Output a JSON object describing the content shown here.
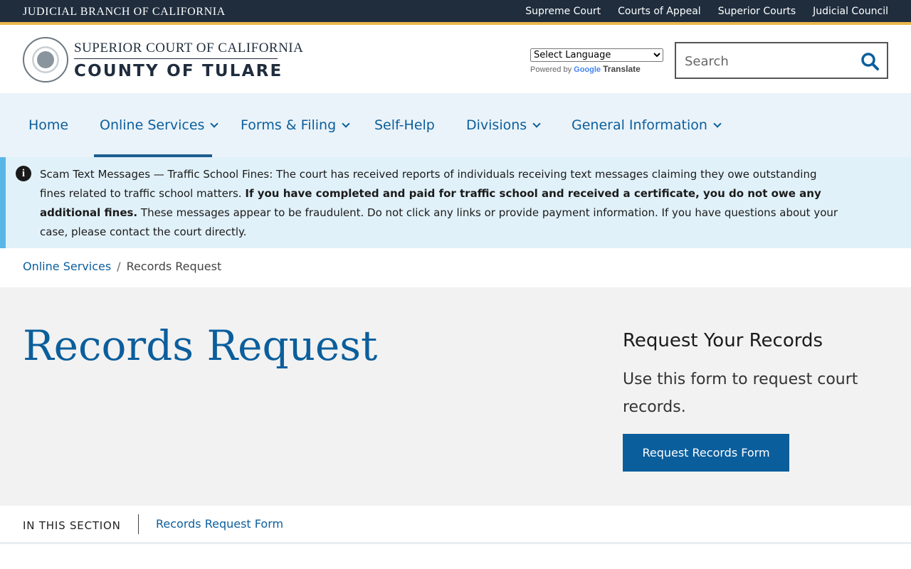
{
  "topbar": {
    "brand": "JUDICIAL BRANCH OF CALIFORNIA",
    "links": [
      "Supreme Court",
      "Courts of Appeal",
      "Superior Courts",
      "Judicial Council"
    ]
  },
  "header": {
    "court_line1": "SUPERIOR COURT OF CALIFORNIA",
    "court_line2": "COUNTY OF TULARE",
    "language_select": "Select Language",
    "powered_by": "Powered by",
    "google": "Google",
    "translate": "Translate",
    "search_placeholder": "Search"
  },
  "nav": {
    "items": [
      {
        "label": "Home"
      },
      {
        "label": "Online Services"
      },
      {
        "label": "Forms & Filing"
      },
      {
        "label": "Self-Help"
      },
      {
        "label": "Divisions"
      },
      {
        "label": "General Information"
      }
    ]
  },
  "alert": {
    "title": "Scam Text Messages — Traffic School Fines:",
    "text1": "The court has received reports of individuals receiving text messages claiming they owe outstanding fines related to traffic school matters.",
    "bold": "If you have completed and paid for traffic school and received a certificate, you do not owe any additional fines.",
    "text2": "These messages appear to be fraudulent. Do not click any links or provide payment information. If you have questions about your case, please contact the court directly."
  },
  "breadcrumb": {
    "parent": "Online Services",
    "separator": "/",
    "current": "Records Request"
  },
  "hero": {
    "title": "Records Request",
    "side_title": "Request Your Records",
    "side_text": "Use this form to request court records.",
    "button": "Request Records Form"
  },
  "section": {
    "label": "IN THIS SECTION",
    "link": "Records Request Form"
  },
  "colors": {
    "topbar": "#1f2d3d",
    "accent_gold": "#e8b84b",
    "link_blue": "#0b5e9c",
    "alert_bg": "#e1f1f9",
    "alert_border": "#58b7e6"
  }
}
